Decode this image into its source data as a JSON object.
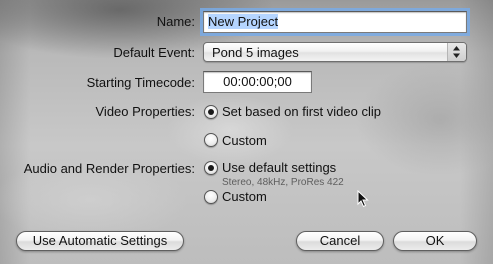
{
  "form": {
    "name_label": "Name:",
    "name_value": "New Project",
    "event_label": "Default Event:",
    "event_value": "Pond 5 images",
    "timecode_label": "Starting Timecode:",
    "timecode_value": "00:00:00;00",
    "video_label": "Video Properties:",
    "video_options": [
      {
        "label": "Set based on first video clip",
        "selected": true
      },
      {
        "label": "Custom",
        "selected": false
      }
    ],
    "audio_label": "Audio and Render Properties:",
    "audio_options": [
      {
        "label": "Use default settings",
        "selected": true
      },
      {
        "label": "Custom",
        "selected": false
      }
    ],
    "audio_hint": "Stereo, 48kHz, ProRes 422"
  },
  "buttons": {
    "auto": "Use Automatic Settings",
    "cancel": "Cancel",
    "ok": "OK"
  },
  "icons": {
    "popup_arrows": "up-down-arrows-icon",
    "cursor": "mouse-pointer-icon"
  }
}
